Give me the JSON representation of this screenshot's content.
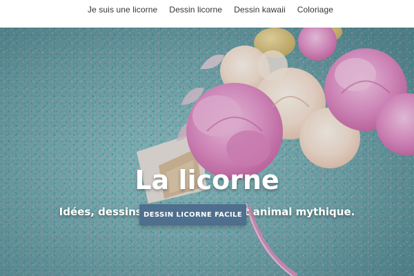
{
  "nav": {
    "items": [
      {
        "label": "Je suis une licorne"
      },
      {
        "label": "Dessin licorne"
      },
      {
        "label": "Dessin kawaii"
      },
      {
        "label": "Coloriage"
      }
    ]
  },
  "hero": {
    "title": "La licorne",
    "subtitle": "Idées, dessins, coloriages de cet animal mythique.",
    "cta_label": "DESSIN LICORNE FACILE"
  },
  "colors": {
    "hero_background": "#7fb6b7",
    "cta_background": "#4f6f8e",
    "nav_text": "#333333"
  }
}
